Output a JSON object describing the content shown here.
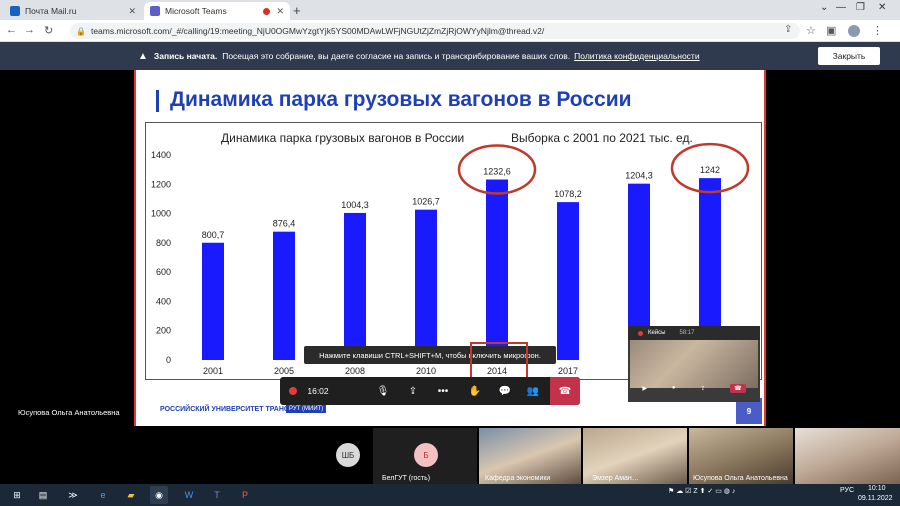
{
  "browser": {
    "tabs": [
      {
        "label": "Почта Mail.ru"
      },
      {
        "label": "Microsoft Teams"
      }
    ],
    "url": "teams.microsoft.com/_#/calling/19:meeting_NjU0OGMwYzgtYjk5YS00MDAwLWFjNGUtZjZmZjRjOWYyNjlm@thread.v2/"
  },
  "banner": {
    "bold": "Запись начата.",
    "text": "Посещая это собрание, вы даете согласие на запись и транскрибирование ваших слов.",
    "link": "Политика конфиденциальности",
    "close_label": "Закрыть"
  },
  "slide": {
    "title": "Динамика парка грузовых вагонов в России",
    "footer": "РОССИЙСКИЙ УНИВЕРСИТЕТ ТРАНСПОРТА",
    "footer_badge": "РУТ (МИИТ)",
    "page_number": "9"
  },
  "chart_data": {
    "type": "bar",
    "title": "Динамика парка грузовых вагонов в России",
    "subtitle": "Выборка с 2001 по 2021 тыс. ед.",
    "categories": [
      "2001",
      "2005",
      "2008",
      "2010",
      "2014",
      "2017",
      "",
      ""
    ],
    "values": [
      800.7,
      876.4,
      1004.3,
      1026.7,
      1232.6,
      1078.2,
      1204.3,
      1242
    ],
    "value_labels": [
      "800,7",
      "876,4",
      "1004,3",
      "1026,7",
      "1232,6",
      "1078,2",
      "1204,3",
      "1242"
    ],
    "ylim": [
      0,
      1400
    ],
    "yticks": [
      "0",
      "200",
      "400",
      "600",
      "800",
      "1000",
      "1200",
      "1400"
    ],
    "bar_color": "#1a1aff",
    "highlighted": [
      4,
      7
    ],
    "highlight_color": "#c0392b"
  },
  "presenter": {
    "name": "Юсупова Ольга Анатольевна"
  },
  "callbar": {
    "timer": "16:02"
  },
  "tooltip": "Нажмите клавиши CTRL+SHIFT+M, чтобы включить микрофон.",
  "mini_window": {
    "title": "Кейсы",
    "time": "58:17"
  },
  "participants": [
    {
      "initials": "ШБ",
      "color": "#d9d9d9",
      "text_color": "#333"
    },
    {
      "initials": "Б",
      "color": "#f3c1c1",
      "text_color": "#a33",
      "name": "БелГУТ (гость)"
    }
  ],
  "video_tiles": [
    {
      "label": "Кафедра экономики"
    },
    {
      "label": "Эмзер Аман…"
    },
    {
      "label": "Юсупова Ольга Анатольевна"
    },
    {
      "label": ""
    }
  ],
  "taskbar": {
    "lang": "РУС",
    "time": "10:10",
    "date": "09.11.2022"
  }
}
